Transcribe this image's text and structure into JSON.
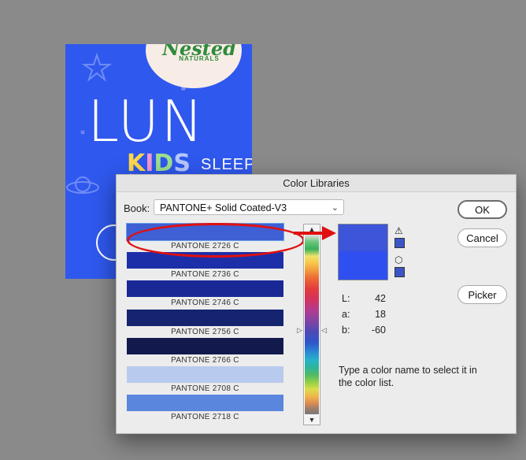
{
  "artwork": {
    "logo": "Nested",
    "logo_sub": "NATURALS",
    "title": "LUN",
    "kids": [
      "K",
      "I",
      "D",
      "S"
    ],
    "sleep": "SLEEP"
  },
  "dialog": {
    "title": "Color Libraries",
    "book_label": "Book:",
    "book_value": "PANTONE+ Solid Coated-V3",
    "buttons": {
      "ok": "OK",
      "cancel": "Cancel",
      "picker": "Picker"
    },
    "swatches": [
      {
        "name": "PANTONE 2726 C",
        "color": "#3f5fd4",
        "selected": true
      },
      {
        "name": "PANTONE 2736 C",
        "color": "#1d2fa8"
      },
      {
        "name": "PANTONE 2746 C",
        "color": "#1a2896"
      },
      {
        "name": "PANTONE 2756 C",
        "color": "#15246f"
      },
      {
        "name": "PANTONE 2766 C",
        "color": "#121a4d"
      },
      {
        "name": "PANTONE 2708 C",
        "color": "#b8caee"
      },
      {
        "name": "PANTONE 2718 C",
        "color": "#5a86dd"
      }
    ],
    "preview": {
      "new_color": "#3d55d8",
      "old_color": "#2f4ff0"
    },
    "lab": [
      {
        "label": "L:",
        "value": "42"
      },
      {
        "label": "a:",
        "value": "18"
      },
      {
        "label": "b:",
        "value": "-60"
      }
    ],
    "hint": "Type a color name to select it in the color list."
  }
}
